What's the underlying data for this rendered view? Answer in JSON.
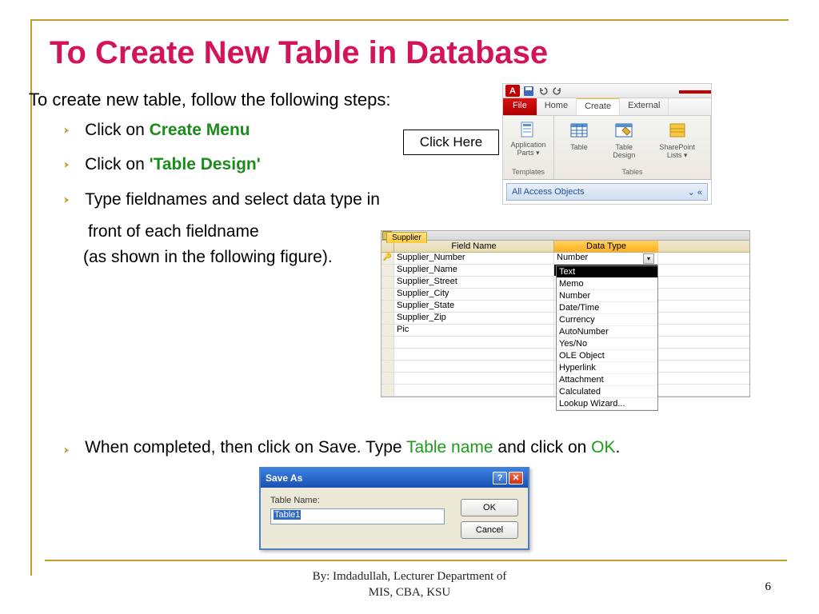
{
  "title": "To Create New Table in Database",
  "intro": "To create new table, follow the following steps:",
  "b1_a": "Click on ",
  "b1_b": "Create Menu",
  "b2_a": "Click on ",
  "b2_b": "'Table Design'",
  "b3": "Type fieldnames and select data type in",
  "b3_sub1": "front of each fieldname",
  "b3_sub2": "(as shown in the following figure).",
  "b4_a": "When completed, then click on Save. Type ",
  "b4_b": "Table name",
  "b4_c": " and click on ",
  "b4_d": "OK",
  "b4_e": ".",
  "callout": "Click Here",
  "ribbon": {
    "a": "A",
    "file": "File",
    "home": "Home",
    "create": "Create",
    "external": "External",
    "app_parts": "Application\nParts ▾",
    "table": "Table",
    "table_design": "Table\nDesign",
    "sp_lists": "SharePoint\nLists ▾",
    "g1": "Templates",
    "g2": "Tables",
    "nav": "All Access Objects",
    "nav_arrows": "⌄  «"
  },
  "design": {
    "tab": "Supplier",
    "h_field": "Field Name",
    "h_type": "Data Type",
    "fields": [
      {
        "key": "🔑",
        "name": "Supplier_Number",
        "type": "Number",
        "first": true
      },
      {
        "key": "",
        "name": "Supplier_Name",
        "type": "Text",
        "sel": true
      },
      {
        "key": "",
        "name": "Supplier_Street",
        "type": "Memo"
      },
      {
        "key": "",
        "name": "Supplier_City",
        "type": "Number"
      },
      {
        "key": "",
        "name": "Supplier_State",
        "type": "Date/Time"
      },
      {
        "key": "",
        "name": "Supplier_Zip",
        "type": "Currency"
      },
      {
        "key": "",
        "name": "Pic",
        "type": "AutoNumber"
      }
    ],
    "dropdown": [
      "Text",
      "Memo",
      "Number",
      "Date/Time",
      "Currency",
      "AutoNumber",
      "Yes/No",
      "OLE Object",
      "Hyperlink",
      "Attachment",
      "Calculated",
      "Lookup Wizard..."
    ]
  },
  "saveas": {
    "title": "Save As",
    "label": "Table Name:",
    "value": "Table1",
    "ok": "OK",
    "cancel": "Cancel"
  },
  "footer1": "By: Imdadullah, Lecturer Department of",
  "footer2": "MIS, CBA, KSU",
  "page": "6"
}
